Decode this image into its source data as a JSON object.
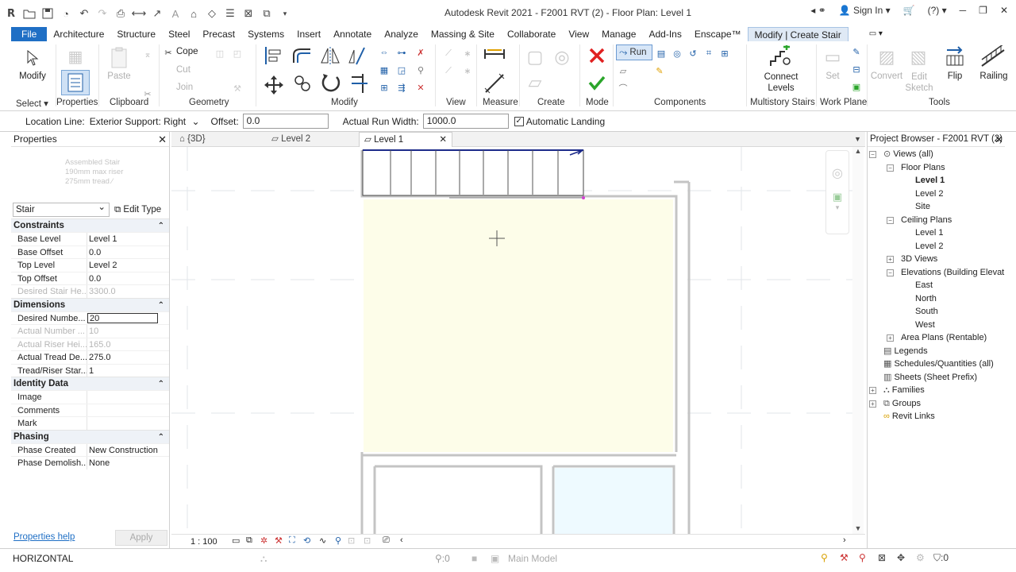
{
  "title_bar": {
    "title": "Autodesk Revit 2021 - F2001 RVT (2) - Floor Plan: Level 1",
    "sign_in": "Sign In",
    "help": "?",
    "minimize": "─",
    "restore": "❐",
    "close": "✕"
  },
  "ribbon_tabs": [
    "File",
    "Architecture",
    "Structure",
    "Steel",
    "Precast",
    "Systems",
    "Insert",
    "Annotate",
    "Analyze",
    "Massing & Site",
    "Collaborate",
    "View",
    "Manage",
    "Add-Ins",
    "Enscape™",
    "Modify | Create Stair"
  ],
  "ribbon": {
    "modify_label": "Modify",
    "cope_label": "Cope",
    "paste_label": "Paste",
    "cut_label": "Cut",
    "join_label": "Join",
    "run_label": "Run",
    "connect_levels_label": "Connect Levels",
    "set_label": "Set",
    "convert_label": "Convert",
    "edit_sketch_label": "Edit Sketch",
    "flip_label": "Flip",
    "railing_label": "Railing",
    "panels": {
      "select": "Select",
      "properties": "Properties",
      "clipboard": "Clipboard",
      "geometry": "Geometry",
      "modify": "Modify",
      "view": "View",
      "measure": "Measure",
      "create": "Create",
      "mode": "Mode",
      "components": "Components",
      "multistory_stairs": "Multistory Stairs",
      "work_plane": "Work Plane",
      "tools": "Tools"
    }
  },
  "options_bar": {
    "location_line_label": "Location Line:",
    "location_line_value": "Exterior Support: Right",
    "offset_label": "Offset:",
    "offset_value": "0.0",
    "run_width_label": "Actual Run Width:",
    "run_width_value": "1000.0",
    "automatic_landing_label": "Automatic Landing",
    "automatic_landing_checked": "✓"
  },
  "properties": {
    "header": "Properties",
    "type_preview_lines": [
      "Assembled Stair",
      "190mm max riser",
      "275mm tread ∕"
    ],
    "instance_selector": "Stair",
    "edit_type": "Edit Type",
    "groups": [
      {
        "name": "Constraints",
        "rows": [
          {
            "k": "Base Level",
            "v": "Level 1"
          },
          {
            "k": "Base Offset",
            "v": "0.0"
          },
          {
            "k": "Top Level",
            "v": "Level 2"
          },
          {
            "k": "Top Offset",
            "v": "0.0"
          },
          {
            "k": "Desired Stair He...",
            "v": "3300.0"
          }
        ]
      },
      {
        "name": "Dimensions",
        "rows": [
          {
            "k": "Desired Numbe...",
            "v": "20"
          },
          {
            "k": "Actual Number ...",
            "v": "10"
          },
          {
            "k": "Actual Riser Hei...",
            "v": "165.0"
          },
          {
            "k": "Actual Tread De...",
            "v": "275.0"
          },
          {
            "k": "Tread/Riser Star...",
            "v": "1"
          }
        ]
      },
      {
        "name": "Identity Data",
        "rows": [
          {
            "k": "Image",
            "v": ""
          },
          {
            "k": "Comments",
            "v": ""
          },
          {
            "k": "Mark",
            "v": ""
          }
        ]
      },
      {
        "name": "Phasing",
        "rows": [
          {
            "k": "Phase Created",
            "v": "New Construction"
          },
          {
            "k": "Phase Demolish...",
            "v": "None"
          }
        ]
      }
    ],
    "help_link": "Properties help",
    "apply": "Apply"
  },
  "view_tabs": [
    {
      "label": "{3D}"
    },
    {
      "label": "Level 2"
    },
    {
      "label": "Level 1"
    }
  ],
  "view_control": {
    "scale": "1 : 100"
  },
  "project_browser": {
    "header": "Project Browser - F2001 RVT (2)",
    "nodes": [
      {
        "label": "Views (all)",
        "indent": 0
      },
      {
        "label": "Floor Plans",
        "indent": 1
      },
      {
        "label": "Level 1",
        "indent": 2
      },
      {
        "label": "Level 2",
        "indent": 2
      },
      {
        "label": "Site",
        "indent": 2
      },
      {
        "label": "Ceiling Plans",
        "indent": 1
      },
      {
        "label": "Level 1",
        "indent": 2
      },
      {
        "label": "Level 2",
        "indent": 2
      },
      {
        "label": "3D Views",
        "indent": 1
      },
      {
        "label": "Elevations (Building Elevation)",
        "indent": 1
      },
      {
        "label": "East",
        "indent": 2
      },
      {
        "label": "North",
        "indent": 2
      },
      {
        "label": "South",
        "indent": 2
      },
      {
        "label": "West",
        "indent": 2
      },
      {
        "label": "Area Plans (Rentable)",
        "indent": 1
      },
      {
        "label": "Legends",
        "indent": 0
      },
      {
        "label": "Schedules/Quantities (all)",
        "indent": 0
      },
      {
        "label": "Sheets (Sheet Prefix)",
        "indent": 0
      },
      {
        "label": "Families",
        "indent": 0
      },
      {
        "label": "Groups",
        "indent": 0
      },
      {
        "label": "Revit Links",
        "indent": 0
      }
    ]
  },
  "status_bar": {
    "message": "HORIZONTAL",
    "workset_count": ":0",
    "model": "Main Model",
    "filter_count": ":0"
  }
}
